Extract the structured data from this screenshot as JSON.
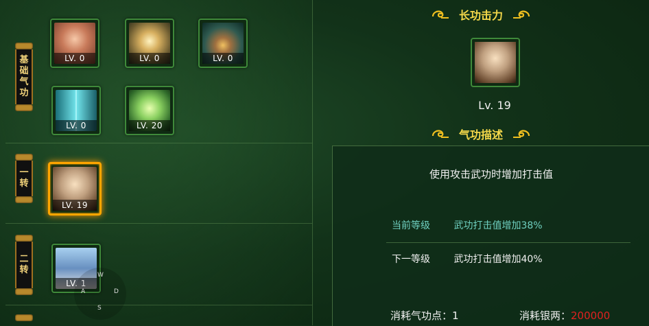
{
  "left": {
    "basic": {
      "banner": [
        "基",
        "础",
        "气",
        "功"
      ],
      "skills": [
        {
          "level": "LV. 0",
          "icon": "meditating-figure-icon"
        },
        {
          "level": "LV. 0",
          "icon": "golden-orb-icon"
        },
        {
          "level": "LV. 0",
          "icon": "energy-gourd-icon"
        },
        {
          "level": "LV. 0",
          "icon": "palm-light-beam-icon"
        },
        {
          "level": "LV. 20",
          "icon": "green-aura-figure-icon"
        }
      ]
    },
    "first_turn": {
      "banner": [
        "一",
        "转"
      ],
      "skills": [
        {
          "level": "LV. 19",
          "icon": "crossed-blades-icon"
        }
      ]
    },
    "second_turn": {
      "banner": [
        "二",
        "转"
      ],
      "skills": [
        {
          "level": "LV. 1",
          "icon": "winged-warrior-icon"
        }
      ]
    },
    "joystick": {
      "w": "W",
      "a": "A",
      "d": "D",
      "s": "S"
    }
  },
  "right": {
    "title": "长功击力",
    "selected_level": "Lv. 19",
    "desc_title": "气功描述",
    "description": "使用攻击武功时增加打击值",
    "current_label": "当前等级",
    "current_value": "武功打击值增加38%",
    "next_label": "下一等级",
    "next_value": "武功打击值增加40%",
    "cost_points_label": "消耗气功点：",
    "cost_points_value": "1",
    "cost_silver_label": "消耗银两：",
    "cost_silver_value": "200000"
  },
  "colors": {
    "accent": "#f5d84a",
    "selected": "#ffa500",
    "current_text": "#6fd0c0",
    "cost_red": "#e02020"
  }
}
